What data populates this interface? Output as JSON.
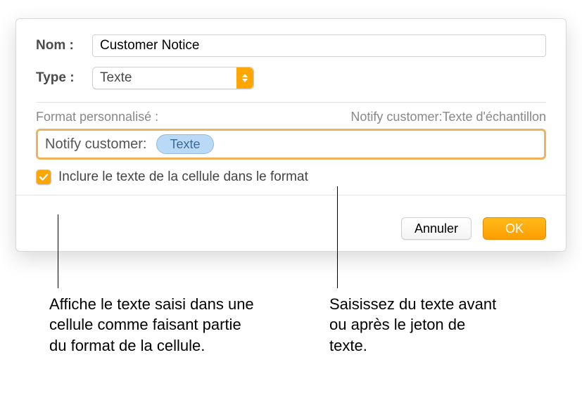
{
  "fields": {
    "name_label": "Nom :",
    "name_value": "Customer Notice",
    "type_label": "Type :",
    "type_value": "Texte"
  },
  "format": {
    "section_label": "Format personnalisé :",
    "preview": "Notify customer:Texte d'échantillon",
    "prefix_text": "Notify customer:",
    "token_label": "Texte"
  },
  "checkbox": {
    "label": "Inclure le texte de la cellule dans le format"
  },
  "buttons": {
    "cancel": "Annuler",
    "ok": "OK"
  },
  "callouts": {
    "left": "Affiche le texte saisi dans une cellule comme faisant partie du format de la cellule.",
    "right": "Saisissez du texte avant ou après le jeton de texte."
  }
}
